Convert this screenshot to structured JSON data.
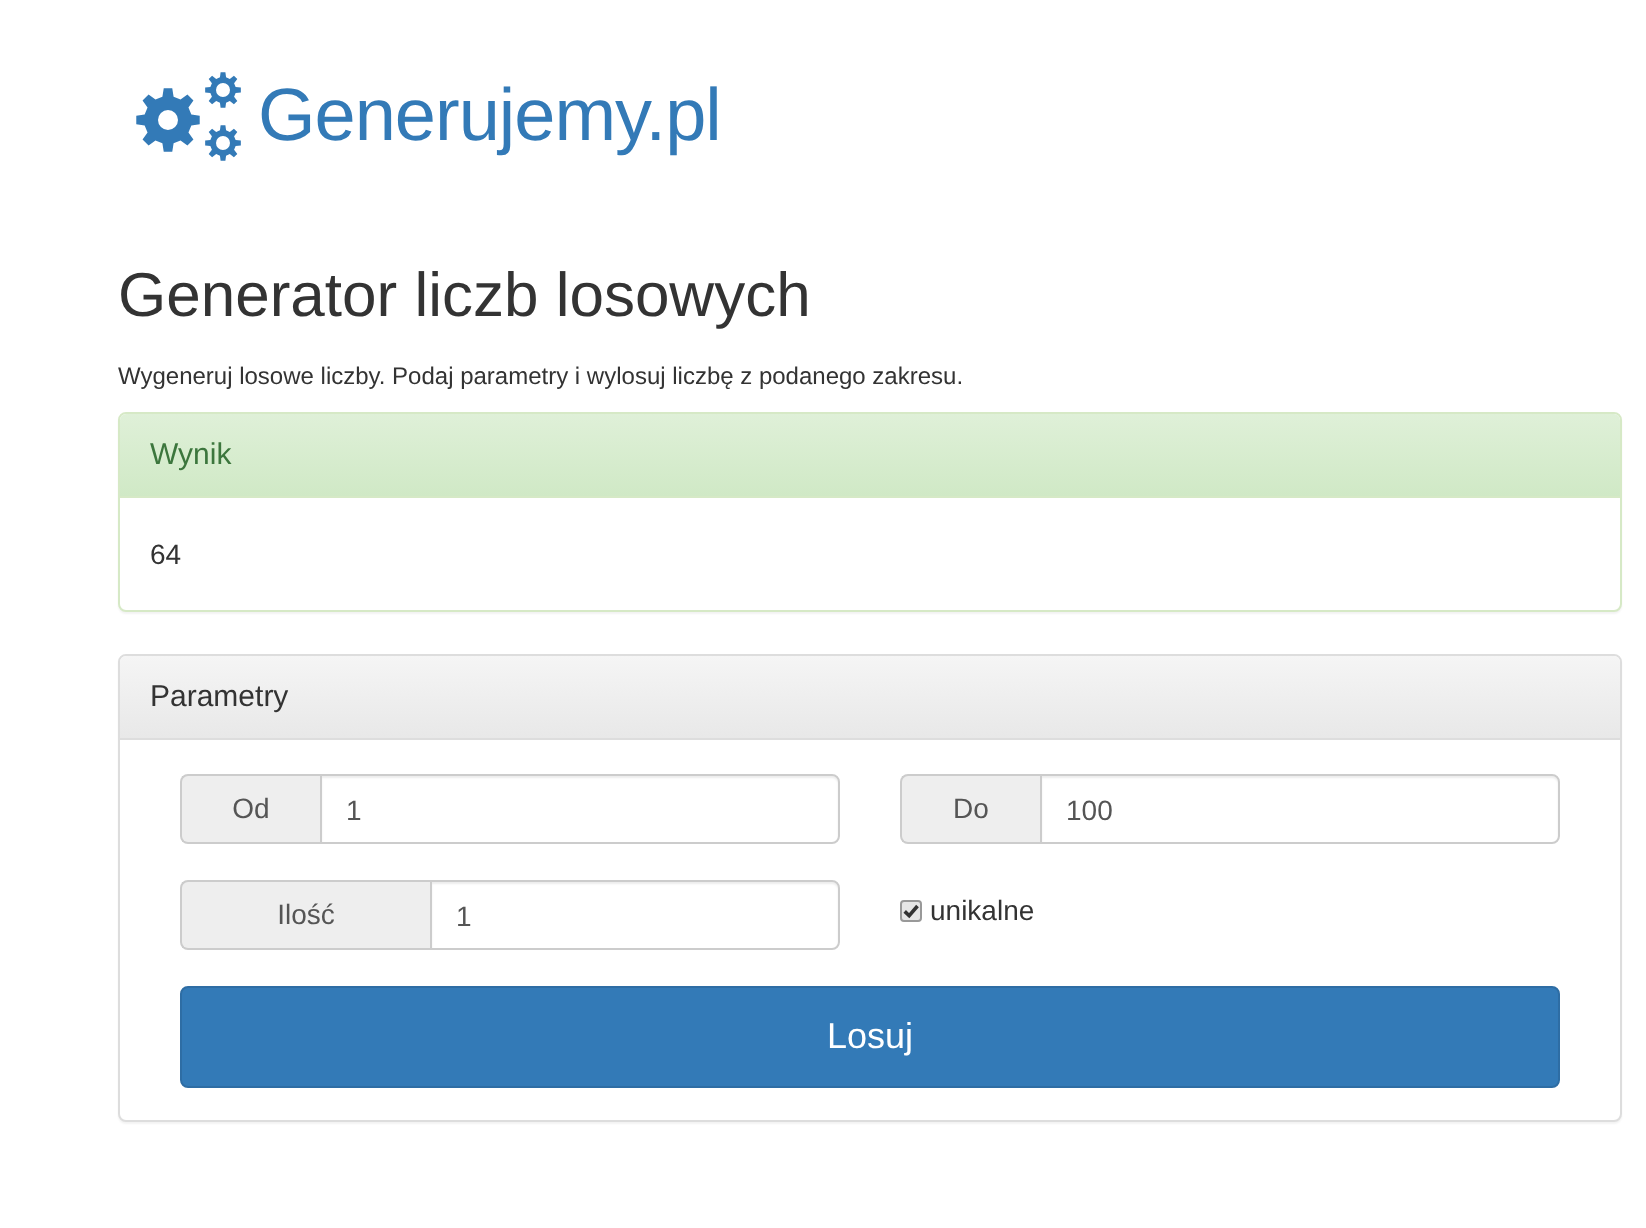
{
  "logo": {
    "text": "Generujemy.pl"
  },
  "title": "Generator liczb losowych",
  "description": "Wygeneruj losowe liczby. Podaj parametry i wylosuj liczbę z podanego zakresu.",
  "result_panel": {
    "heading": "Wynik",
    "value": "64"
  },
  "parameters_panel": {
    "heading": "Parametry",
    "fields": [
      {
        "label": "Od",
        "value": "1"
      },
      {
        "label": "Do",
        "value": "100"
      },
      {
        "label": "Ilość",
        "value": "1"
      }
    ],
    "unique_checkbox": {
      "label": "unikalne",
      "checked": true
    },
    "submit_button": "Losuj"
  }
}
